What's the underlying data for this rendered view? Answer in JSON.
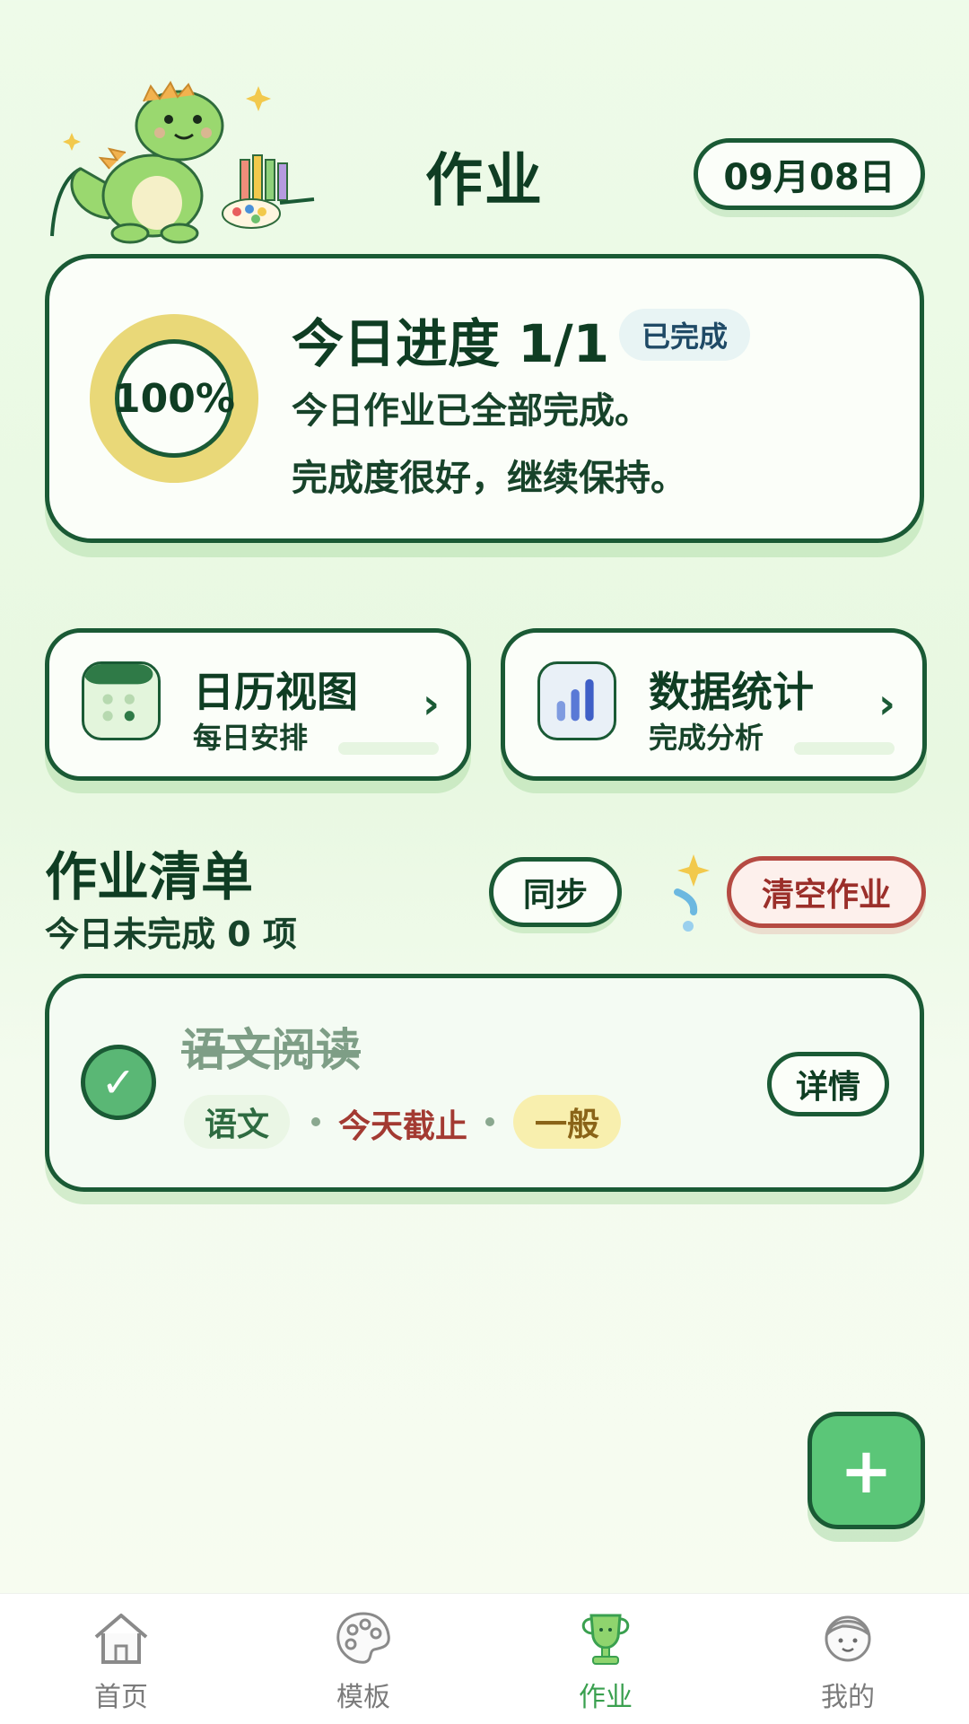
{
  "header": {
    "title": "作业",
    "date": "09月08日"
  },
  "progress": {
    "percent_text": "100%",
    "percent": 1.0,
    "title": "今日进度 1/1",
    "badge": "已完成",
    "line1": "今日作业已全部完成。",
    "line2": "完成度很好，继续保持。"
  },
  "shortcuts": [
    {
      "title": "日历视图",
      "subtitle": "每日安排",
      "chevron": "›",
      "icon": "calendar-icon"
    },
    {
      "title": "数据统计",
      "subtitle": "完成分析",
      "chevron": "›",
      "icon": "bar-chart-icon"
    }
  ],
  "homework": {
    "title": "作业清单",
    "subtitle": "今日未完成 0 项",
    "sync_label": "同步",
    "clear_label": "清空作业",
    "tasks": [
      {
        "title": "语文阅读",
        "subject": "语文",
        "due": "今天截止",
        "priority": "一般",
        "detail_label": "详情",
        "completed": true,
        "check": "✓"
      }
    ]
  },
  "fab": {
    "label": "+"
  },
  "bottom_nav": {
    "items": [
      {
        "label": "首页",
        "icon": "home-icon",
        "active": false
      },
      {
        "label": "模板",
        "icon": "palette-icon",
        "active": false
      },
      {
        "label": "作业",
        "icon": "trophy-icon",
        "active": true
      },
      {
        "label": "我的",
        "icon": "profile-icon",
        "active": false
      }
    ]
  },
  "colors": {
    "primary_dark": "#1a5a35",
    "accent_green": "#5bc678",
    "ring_yellow": "#e9d878",
    "danger": "#b54a42",
    "nav_active": "#3aa04f"
  }
}
